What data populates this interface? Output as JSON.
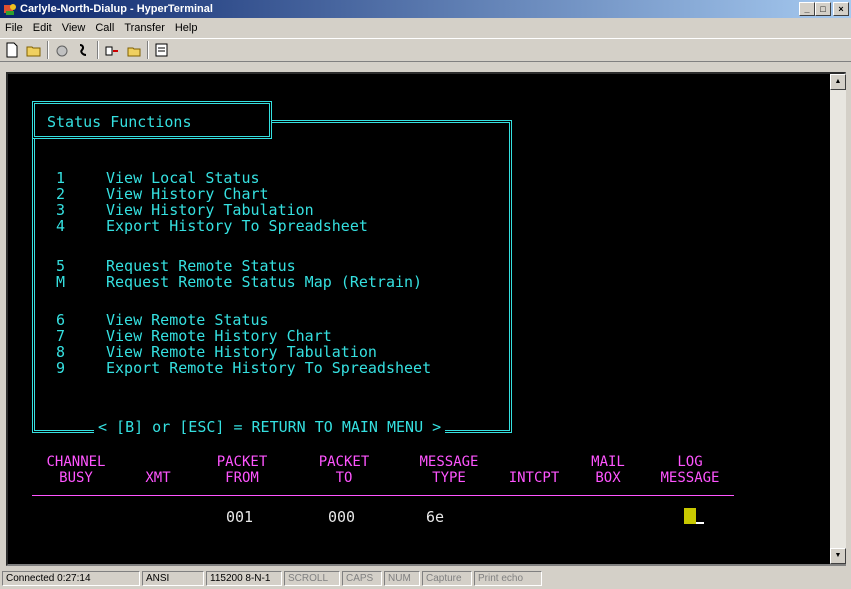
{
  "window": {
    "title": "Carlyle-North-Dialup - HyperTerminal"
  },
  "menu": [
    "File",
    "Edit",
    "View",
    "Call",
    "Transfer",
    "Help"
  ],
  "toolbar": [
    "new-icon",
    "open-icon",
    "disconnect-icon",
    "dial-icon",
    "send-icon",
    "receive-icon",
    "properties-icon"
  ],
  "terminal": {
    "box_title": "Status Functions",
    "items": [
      {
        "key": "1",
        "label": "View Local Status"
      },
      {
        "key": "2",
        "label": "View History Chart"
      },
      {
        "key": "3",
        "label": "View History Tabulation"
      },
      {
        "key": "4",
        "label": "Export History To Spreadsheet"
      },
      {
        "key": "5",
        "label": "Request Remote Status"
      },
      {
        "key": "M",
        "label": "Request Remote Status Map (Retrain)"
      },
      {
        "key": "6",
        "label": "View Remote Status"
      },
      {
        "key": "7",
        "label": "View Remote History Chart"
      },
      {
        "key": "8",
        "label": "View Remote History Tabulation"
      },
      {
        "key": "9",
        "label": "Export Remote History To Spreadsheet"
      }
    ],
    "return_text": "< [B] or [ESC] = RETURN TO MAIN MENU >",
    "headers": [
      {
        "l1": "CHANNEL",
        "l2": "BUSY"
      },
      {
        "l1": "",
        "l2": "XMT"
      },
      {
        "l1": "PACKET",
        "l2": "FROM"
      },
      {
        "l1": "PACKET",
        "l2": "TO"
      },
      {
        "l1": "MESSAGE",
        "l2": "TYPE"
      },
      {
        "l1": "",
        "l2": "INTCPT"
      },
      {
        "l1": "MAIL",
        "l2": "BOX"
      },
      {
        "l1": "LOG",
        "l2": "MESSAGE"
      }
    ],
    "values": {
      "packet_from": "001",
      "packet_to": "000",
      "message_type": "6e"
    }
  },
  "status": {
    "connected": "Connected 0:27:14",
    "emulation": "ANSI",
    "settings": "115200 8-N-1",
    "scroll": "SCROLL",
    "caps": "CAPS",
    "num": "NUM",
    "capture": "Capture",
    "print_echo": "Print echo"
  }
}
